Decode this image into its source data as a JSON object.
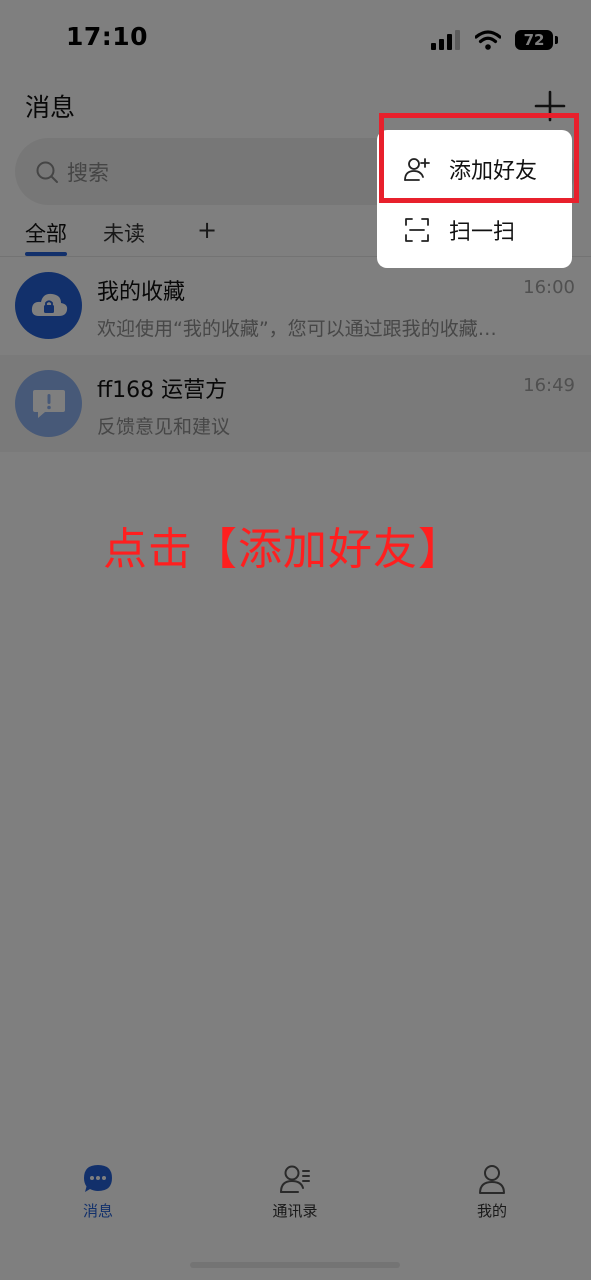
{
  "status_bar": {
    "time": "17:10",
    "battery": "72"
  },
  "header": {
    "title": "消息"
  },
  "search": {
    "placeholder": "搜索"
  },
  "tabs": [
    {
      "label": "全部",
      "active": true
    },
    {
      "label": "未读",
      "active": false
    }
  ],
  "conversations": [
    {
      "title": "我的收藏",
      "preview": "欢迎使用“我的收藏”，您可以通过跟我的收藏…",
      "time": "16:00",
      "icon": "cloud-lock-icon"
    },
    {
      "title": "ff168 运营方",
      "preview": "反馈意见和建议",
      "time": "16:49",
      "icon": "feedback-icon"
    }
  ],
  "bottom_nav": [
    {
      "label": "消息",
      "icon": "chat-bubble-icon",
      "active": true
    },
    {
      "label": "通讯录",
      "icon": "contacts-icon",
      "active": false
    },
    {
      "label": "我的",
      "icon": "profile-icon",
      "active": false
    }
  ],
  "popup_menu": {
    "items": [
      {
        "label": "添加好友",
        "icon": "add-friend-icon"
      },
      {
        "label": "扫一扫",
        "icon": "scan-icon"
      }
    ]
  },
  "instruction": "点击【添加好友】",
  "colors": {
    "accent": "#2461d6",
    "highlight": "#e8202c",
    "instruction": "#ff1f1f"
  }
}
